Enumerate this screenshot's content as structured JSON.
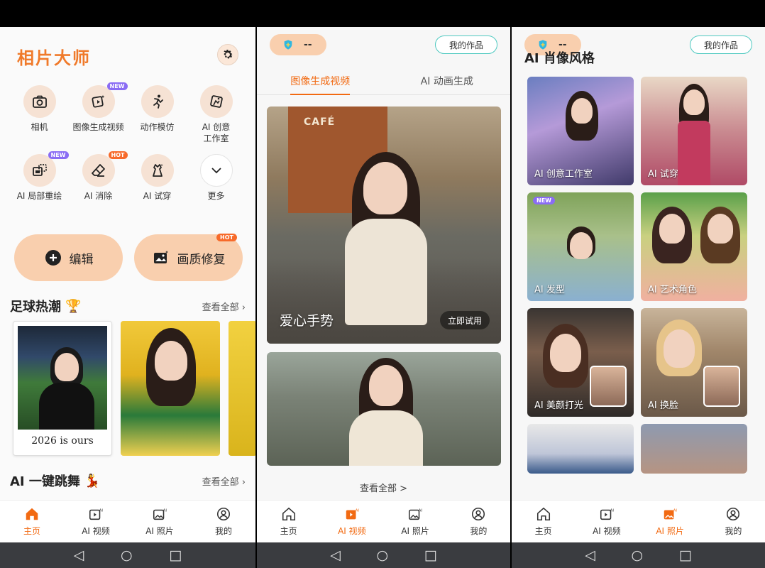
{
  "colors": {
    "accent": "#f26a12",
    "peach": "#f9cfae",
    "teal": "#4ec9c0"
  },
  "screen1": {
    "app_title": "相片大师",
    "tools": [
      {
        "label": "相机",
        "icon": "camera-icon",
        "badge": ""
      },
      {
        "label": "图像生成视频",
        "icon": "image-to-video-icon",
        "badge": "NEW"
      },
      {
        "label": "动作模仿",
        "icon": "pose-icon",
        "badge": ""
      },
      {
        "label": "AI 创意\n工作室",
        "icon": "creative-icon",
        "badge": ""
      },
      {
        "label": "AI 局部重绘",
        "icon": "repaint-icon",
        "badge": "NEW"
      },
      {
        "label": "AI 消除",
        "icon": "eraser-icon",
        "badge": "HOT"
      },
      {
        "label": "AI 试穿",
        "icon": "dress-icon",
        "badge": ""
      },
      {
        "label": "更多",
        "icon": "chevron-down-icon",
        "badge": ""
      }
    ],
    "edit_label": "编辑",
    "restore_label": "画质修复",
    "restore_badge": "HOT",
    "section1_title": "足球热潮",
    "section1_more": "查看全部",
    "polaroid_caption": "2026 is ours",
    "section2_title": "AI 一键跳舞",
    "section2_more": "查看全部"
  },
  "screen2": {
    "pill_value": "--",
    "works_label": "我的作品",
    "subtabs": [
      "图像生成视频",
      "AI 动画生成"
    ],
    "hero1_title": "爱心手势",
    "hero1_button": "立即试用",
    "view_all": "查看全部 >"
  },
  "screen3": {
    "pill_value": "--",
    "works_label": "我的作品",
    "section_title": "AI 肖像风格",
    "cards": [
      {
        "label": "AI 创意工作室",
        "badge": ""
      },
      {
        "label": "AI 试穿",
        "badge": ""
      },
      {
        "label": "AI 发型",
        "badge": "NEW"
      },
      {
        "label": "AI 艺术角色",
        "badge": ""
      },
      {
        "label": "AI 美颜打光",
        "badge": ""
      },
      {
        "label": "AI 换脸",
        "badge": ""
      }
    ]
  },
  "tabbar": [
    "主页",
    "AI 视频",
    "AI 照片",
    "我的"
  ],
  "tabbar_active": {
    "screen1": 0,
    "screen2": 1,
    "screen3": 2
  }
}
